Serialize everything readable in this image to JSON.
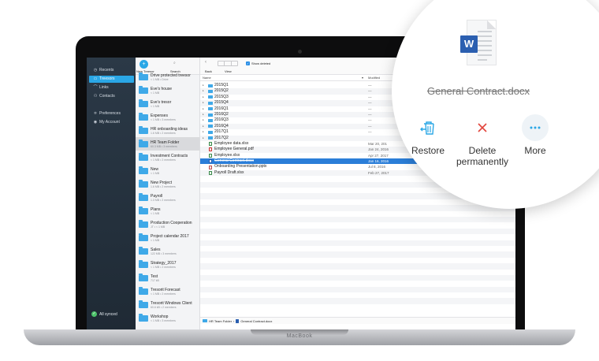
{
  "device_label": "MacBook",
  "sidebar": {
    "items": [
      {
        "label": "Recents",
        "icon": "clock-icon"
      },
      {
        "label": "Treesors",
        "icon": "folder-icon",
        "active": true
      },
      {
        "label": "Links",
        "icon": "link-icon"
      },
      {
        "label": "Contacts",
        "icon": "person-icon"
      },
      {
        "label": "Preferences",
        "icon": "sliders-icon"
      },
      {
        "label": "My Account",
        "icon": "account-icon"
      }
    ],
    "status": "All synced"
  },
  "treesor_list": {
    "new_label": "New Treesor",
    "search_label": "Search",
    "items": [
      {
        "name": "Drive protected treesor",
        "meta": "< 1 MB • Drive"
      },
      {
        "name": "Eve's house",
        "meta": "< 1 MB"
      },
      {
        "name": "Eve's tresor",
        "meta": "< 1 MB"
      },
      {
        "name": "Expenses",
        "meta": "< 1 MB • 3 members"
      },
      {
        "name": "HR onboarding ideas",
        "meta": "1.6 MB • 2 members"
      },
      {
        "name": "HR Team Folder",
        "meta": "60.3 MB • 3 members",
        "selected": true
      },
      {
        "name": "Investment Contracts",
        "meta": "< 1 MB • 2 members"
      },
      {
        "name": "New",
        "meta": "< 1 MB"
      },
      {
        "name": "New Project",
        "meta": "1.6 MB • 2 members"
      },
      {
        "name": "Payroll",
        "meta": "1.3 MB • 2 members"
      },
      {
        "name": "Plans",
        "meta": "< 1 MB"
      },
      {
        "name": "Production Cooperation",
        "meta": "JT • < 1 MB"
      },
      {
        "name": "Project calendar 2017",
        "meta": "< 1 MB"
      },
      {
        "name": "Sales",
        "meta": "122 MB • 3 members"
      },
      {
        "name": "Strategy_2017",
        "meta": "< 1 MB • 2 members"
      },
      {
        "name": "Test",
        "meta": "717 kB"
      },
      {
        "name": "Tresorit Forecast",
        "meta": "< 1 MB • 2 members"
      },
      {
        "name": "Tresorit Windows Client",
        "meta": "60.6 kB • 2 members"
      },
      {
        "name": "Workshop",
        "meta": "< 1 MB • 3 members"
      }
    ]
  },
  "toolbar": {
    "back_label": "Back",
    "view_label": "View",
    "show_deleted_label": "Show deleted",
    "show_deleted_checked": true
  },
  "columns": {
    "name": "Name",
    "modified": "Modified"
  },
  "files": [
    {
      "name": "2015Q1",
      "type": "folder",
      "date": "—"
    },
    {
      "name": "2015Q2",
      "type": "folder",
      "date": "—"
    },
    {
      "name": "2015Q3",
      "type": "folder",
      "date": "—"
    },
    {
      "name": "2015Q4",
      "type": "folder",
      "date": "—"
    },
    {
      "name": "2016Q1",
      "type": "folder",
      "date": "—"
    },
    {
      "name": "2016Q2",
      "type": "folder",
      "date": "—"
    },
    {
      "name": "2016Q3",
      "type": "folder",
      "date": "—"
    },
    {
      "name": "2016Q4",
      "type": "folder",
      "date": "—"
    },
    {
      "name": "2017Q1",
      "type": "folder",
      "date": "—"
    },
    {
      "name": "2017Q2",
      "type": "folder",
      "date": ""
    },
    {
      "name": "Employee data.xlsx",
      "type": "xls",
      "date": "Mar 20, 201"
    },
    {
      "name": "Employee General.pdf",
      "type": "pdf",
      "date": "Jan 24, 2016"
    },
    {
      "name": "Employee.xlsx",
      "type": "xls",
      "date": "Apr 27, 2017"
    },
    {
      "name": "General Contract.docx",
      "type": "doc-w",
      "date": "Jan 16, 2016",
      "selected": true
    },
    {
      "name": "Onboarding Presentation.pptx",
      "type": "ppt",
      "date": "Jul 8, 2016"
    },
    {
      "name": "Payroll Draft.xlsx",
      "type": "xls",
      "date": "Feb 27, 2017"
    }
  ],
  "pathbar": {
    "folder": "HR Team Folder",
    "separator": "›",
    "file": "General Contract.docx"
  },
  "popup": {
    "doc_badge": "W",
    "file_name": "General Contract.docx",
    "actions": [
      {
        "label": "Restore",
        "icon": "restore-trash-icon"
      },
      {
        "label": "Delete permanently",
        "icon": "close-x-icon"
      },
      {
        "label": "More",
        "icon": "more-dots-icon"
      }
    ],
    "colors": {
      "restore": "#2aa7e6",
      "delete": "#e2453c",
      "more": "#2aa7e6",
      "word": "#2b5fb0"
    }
  }
}
